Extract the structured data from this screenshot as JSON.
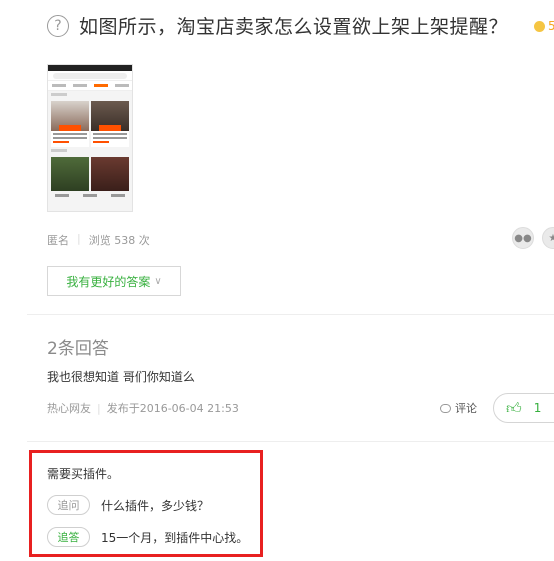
{
  "question": {
    "icon": "question-circle-icon",
    "icon_glyph": "?",
    "title": "如图所示，淘宝店卖家怎么设置欲上架上架提醒？",
    "reward": "5"
  },
  "meta": {
    "author": "匿名",
    "views": "浏览 538 次"
  },
  "share": {
    "icons": [
      "wechat-icon",
      "qzone-icon"
    ]
  },
  "better_answer_button": {
    "label": "我有更好的答案",
    "chevron": "∨"
  },
  "answers": {
    "count_label": "2条回答",
    "first": {
      "text": "我也很想知道 哥们你知道么",
      "author": "热心网友",
      "posted": "发布于2016-06-04 21:53",
      "comment_label": "评论",
      "likes": "1"
    },
    "second": {
      "text": "需要买插件。",
      "followups": [
        {
          "tag": "追问",
          "kind": "ask",
          "text": "什么插件，多少钱？"
        },
        {
          "tag": "追答",
          "kind": "ans",
          "text": "15一个月，到插件中心找。"
        }
      ]
    }
  },
  "colors": {
    "accent_green": "#38b03f",
    "highlight_red": "#e82020",
    "taobao_orange": "#ff5000"
  }
}
